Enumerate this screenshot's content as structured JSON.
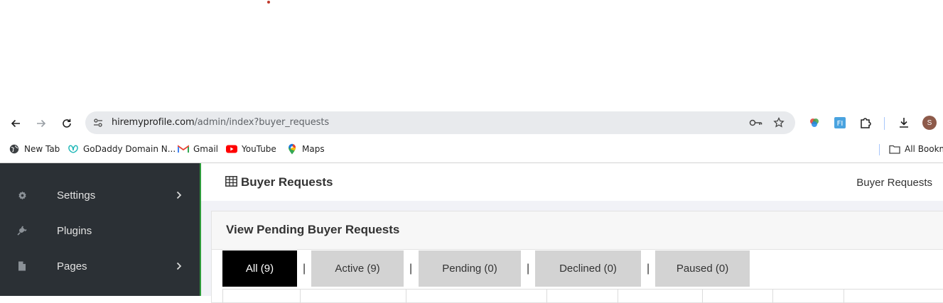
{
  "browser": {
    "url_host": "hiremyprofile.com",
    "url_path": "/admin/index?buyer_requests",
    "avatar_letter": "S",
    "bookmarks": [
      {
        "label": "New Tab",
        "icon": "globe-icon"
      },
      {
        "label": "GoDaddy Domain N...",
        "icon": "godaddy-icon"
      },
      {
        "label": "Gmail",
        "icon": "gmail-icon"
      },
      {
        "label": "YouTube",
        "icon": "youtube-icon"
      },
      {
        "label": "Maps",
        "icon": "maps-icon"
      }
    ],
    "all_bookmarks": "All Bookm"
  },
  "sidebar": {
    "items": [
      {
        "label": "Settings",
        "icon": "gear-icon",
        "has_submenu": true
      },
      {
        "label": "Plugins",
        "icon": "plug-icon",
        "has_submenu": false
      },
      {
        "label": "Pages",
        "icon": "page-icon",
        "has_submenu": true
      }
    ]
  },
  "header": {
    "title": "Buyer Requests",
    "breadcrumb": "Buyer Requests"
  },
  "card": {
    "title": "View Pending Buyer Requests",
    "tabs": [
      {
        "label": "All (9)",
        "active": true
      },
      {
        "label": "Active (9)",
        "active": false
      },
      {
        "label": "Pending (0)",
        "active": false
      },
      {
        "label": "Declined (0)",
        "active": false
      },
      {
        "label": "Paused (0)",
        "active": false
      }
    ],
    "separator": "|"
  },
  "colors": {
    "sidebar_bg": "#2b3035",
    "accent_green": "#2e9a3c",
    "active_tab_bg": "#000000",
    "inactive_tab_bg": "#d3d3d3"
  }
}
